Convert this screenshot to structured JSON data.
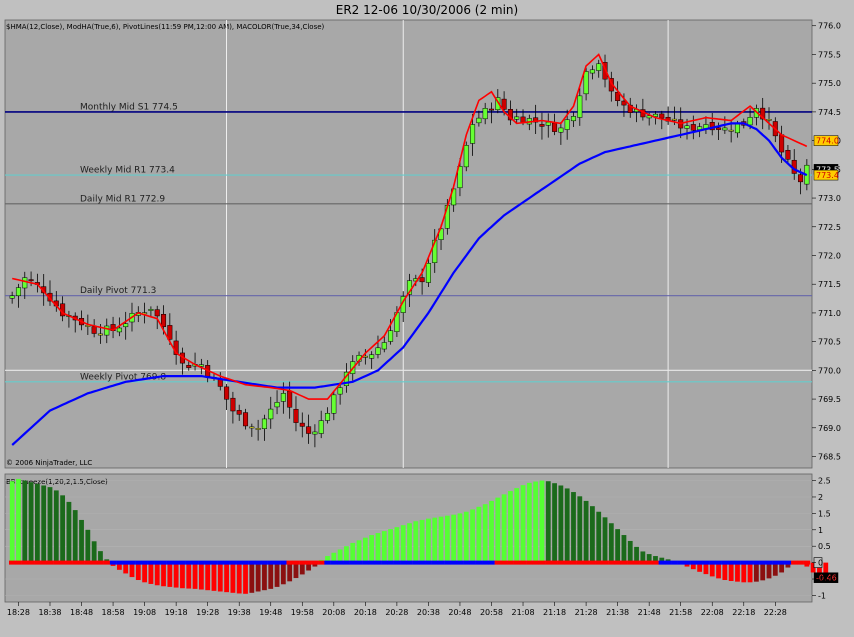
{
  "title": "ER2 12-06  10/30/2006  (2 min)",
  "price_indicator_label": "$HMA(12,Close), ModHA(True,6), PivotLines(11:59 PM,12:00 AM), MACOLOR(True,34,Close)",
  "copyright": "© 2006 NinjaTrader, LLC",
  "osc_indicator_label": "BBSqueeze(1,20,2,1.5,Close)",
  "colors": {
    "background": "#c0c0c0",
    "bull_candle": "#66ff33",
    "bear_candle": "#cc0000",
    "doji_candle": "#ffff33",
    "hma": "#ff0000",
    "ma": "#0000ff",
    "hist_pos_up": "#55ff33",
    "hist_pos_down": "#1b6a1b",
    "hist_neg_down": "#ff0000",
    "hist_neg_up": "#8b1010",
    "squeeze_on": "#ff0000",
    "squeeze_off": "#0000ff"
  },
  "chart_data": [
    {
      "type": "candlestick",
      "panel": "price",
      "ylim": [
        768.3,
        776.1
      ],
      "ticks": [
        776.0,
        775.5,
        775.0,
        774.5,
        774.0,
        773.5,
        773.0,
        772.5,
        772.0,
        771.5,
        771.0,
        770.5,
        770.0,
        769.5,
        769.0,
        768.5
      ],
      "tick_labels": [
        "776.0",
        "775.5",
        "775.0",
        "774.5",
        "774.0",
        "773.5",
        "773.0",
        "772.5",
        "772.0",
        "771.5",
        "771.0",
        "770.5",
        "770.0",
        "769.5",
        "769.0",
        "768.5"
      ],
      "time_labels": [
        "18:28",
        "18:38",
        "18:48",
        "18:58",
        "19:08",
        "19:18",
        "19:28",
        "19:38",
        "19:48",
        "19:58",
        "20:08",
        "20:18",
        "20:28",
        "20:38",
        "20:48",
        "20:58",
        "21:08",
        "21:18",
        "21:28",
        "21:38",
        "21:48",
        "21:58",
        "22:08",
        "22:18",
        "22:28"
      ],
      "close_path": [
        [
          0,
          771.3
        ],
        [
          2,
          771.6
        ],
        [
          5,
          771.4
        ],
        [
          8,
          771.0
        ],
        [
          10,
          770.9
        ],
        [
          13,
          770.7
        ],
        [
          16,
          770.7
        ],
        [
          20,
          771.0
        ],
        [
          22,
          771.1
        ],
        [
          25,
          770.6
        ],
        [
          27,
          770.1
        ],
        [
          30,
          770.1
        ],
        [
          33,
          769.7
        ],
        [
          35,
          769.3
        ],
        [
          37,
          769.1
        ],
        [
          39,
          769.0
        ],
        [
          41,
          769.3
        ],
        [
          43,
          769.6
        ],
        [
          45,
          769.1
        ],
        [
          47,
          768.9
        ],
        [
          49,
          769.1
        ],
        [
          51,
          769.5
        ],
        [
          53,
          770.0
        ],
        [
          55,
          770.2
        ],
        [
          57,
          770.3
        ],
        [
          59,
          770.5
        ],
        [
          61,
          771.0
        ],
        [
          63,
          771.5
        ],
        [
          65,
          771.6
        ],
        [
          67,
          772.2
        ],
        [
          69,
          772.8
        ],
        [
          71,
          773.5
        ],
        [
          73,
          774.3
        ],
        [
          75,
          774.5
        ],
        [
          77,
          774.7
        ],
        [
          79,
          774.4
        ],
        [
          81,
          774.4
        ],
        [
          84,
          774.3
        ],
        [
          87,
          774.2
        ],
        [
          89,
          774.5
        ],
        [
          91,
          775.2
        ],
        [
          93,
          775.4
        ],
        [
          95,
          774.8
        ],
        [
          97,
          774.6
        ],
        [
          99,
          774.5
        ],
        [
          103,
          774.4
        ],
        [
          107,
          774.2
        ],
        [
          110,
          774.3
        ],
        [
          113,
          774.2
        ],
        [
          116,
          774.3
        ],
        [
          118,
          774.6
        ],
        [
          120,
          774.3
        ],
        [
          122,
          773.8
        ],
        [
          124,
          773.4
        ],
        [
          125,
          773.3
        ],
        [
          126,
          773.5
        ]
      ],
      "hma_path": [
        [
          0,
          771.6
        ],
        [
          4,
          771.5
        ],
        [
          8,
          771.0
        ],
        [
          12,
          770.8
        ],
        [
          16,
          770.7
        ],
        [
          20,
          771.0
        ],
        [
          23,
          770.9
        ],
        [
          26,
          770.3
        ],
        [
          29,
          770.1
        ],
        [
          33,
          769.9
        ],
        [
          37,
          769.75
        ],
        [
          41,
          769.7
        ],
        [
          44,
          769.65
        ],
        [
          47,
          769.5
        ],
        [
          50,
          769.5
        ],
        [
          53,
          769.9
        ],
        [
          56,
          770.3
        ],
        [
          59,
          770.6
        ],
        [
          62,
          771.2
        ],
        [
          65,
          771.7
        ],
        [
          68,
          772.5
        ],
        [
          70,
          773.2
        ],
        [
          72,
          774.1
        ],
        [
          74,
          774.7
        ],
        [
          76,
          774.85
        ],
        [
          78,
          774.5
        ],
        [
          80,
          774.3
        ],
        [
          84,
          774.35
        ],
        [
          87,
          774.3
        ],
        [
          89,
          774.6
        ],
        [
          91,
          775.3
        ],
        [
          93,
          775.5
        ],
        [
          95,
          775.0
        ],
        [
          98,
          774.6
        ],
        [
          102,
          774.4
        ],
        [
          106,
          774.3
        ],
        [
          110,
          774.4
        ],
        [
          114,
          774.35
        ],
        [
          117,
          774.6
        ],
        [
          120,
          774.3
        ],
        [
          122,
          774.1
        ],
        [
          124,
          774.0
        ],
        [
          126,
          773.9
        ]
      ],
      "ma_path": [
        [
          0,
          768.7
        ],
        [
          6,
          769.3
        ],
        [
          12,
          769.6
        ],
        [
          18,
          769.8
        ],
        [
          24,
          769.9
        ],
        [
          30,
          769.9
        ],
        [
          36,
          769.8
        ],
        [
          42,
          769.7
        ],
        [
          48,
          769.7
        ],
        [
          54,
          769.8
        ],
        [
          58,
          770.0
        ],
        [
          62,
          770.4
        ],
        [
          66,
          771.0
        ],
        [
          70,
          771.7
        ],
        [
          74,
          772.3
        ],
        [
          78,
          772.7
        ],
        [
          82,
          773.0
        ],
        [
          86,
          773.3
        ],
        [
          90,
          773.6
        ],
        [
          94,
          773.8
        ],
        [
          98,
          773.9
        ],
        [
          102,
          774.0
        ],
        [
          106,
          774.1
        ],
        [
          110,
          774.2
        ],
        [
          114,
          774.3
        ],
        [
          116,
          774.3
        ],
        [
          118,
          774.2
        ],
        [
          120,
          774.0
        ],
        [
          122,
          773.7
        ],
        [
          124,
          773.5
        ],
        [
          126,
          773.4
        ]
      ],
      "levels": [
        {
          "name": "Weekly R1 / Monthly Mid",
          "value": 774.5,
          "color": "#000080",
          "label": "Monthly Mid S1 774.5"
        },
        {
          "name": "Weekly Mid R1",
          "value": 773.4,
          "color": "#66cccc",
          "label": "Weekly Mid R1 773.4"
        },
        {
          "name": "Daily Mid R1",
          "value": 772.9,
          "color": "#666666",
          "label": "Daily Mid R1 772.9"
        },
        {
          "name": "Daily Pivot",
          "value": 771.3,
          "color": "#6666aa",
          "label": "Daily Pivot 771.3"
        },
        {
          "name": "Weekly Pivot",
          "value": 769.8,
          "color": "#66cccc",
          "label": "Weekly Pivot 769.8"
        },
        {
          "name": "Level 770.0",
          "value": 770.0,
          "color": "#e8e8e8",
          "label": ""
        }
      ],
      "badges": [
        {
          "value": 774.0,
          "label": "774.0",
          "bg": "#ffcc00",
          "fg": "#cc0000"
        },
        {
          "value": 773.5,
          "label": "773.5",
          "bg": "#000000",
          "fg": "#ffffff"
        },
        {
          "value": 773.4,
          "label": "773.4",
          "bg": "#ffcc00",
          "fg": "#cc0000"
        }
      ]
    },
    {
      "type": "bar",
      "panel": "oscillator",
      "ylim": [
        -1.2,
        2.7
      ],
      "ticks": [
        2.5,
        2.0,
        1.5,
        1.0,
        0.5,
        0.0,
        -0.5,
        -1.0
      ],
      "tick_labels": [
        "2.5",
        "2",
        "1.5",
        "1",
        "0.5",
        "0",
        "-0.5",
        "-1"
      ],
      "current_value_label": "-0.46",
      "values": [
        2.48,
        2.55,
        2.5,
        2.45,
        2.4,
        2.35,
        2.3,
        2.2,
        2.05,
        1.85,
        1.6,
        1.3,
        1.0,
        0.65,
        0.35,
        0.1,
        -0.1,
        -0.22,
        -0.33,
        -0.44,
        -0.53,
        -0.6,
        -0.65,
        -0.69,
        -0.72,
        -0.74,
        -0.76,
        -0.78,
        -0.79,
        -0.8,
        -0.82,
        -0.84,
        -0.86,
        -0.88,
        -0.9,
        -0.92,
        -0.94,
        -0.95,
        -0.92,
        -0.88,
        -0.84,
        -0.8,
        -0.74,
        -0.66,
        -0.57,
        -0.47,
        -0.36,
        -0.24,
        -0.12,
        0.08,
        0.2,
        0.3,
        0.4,
        0.5,
        0.6,
        0.68,
        0.76,
        0.84,
        0.9,
        0.96,
        1.02,
        1.08,
        1.14,
        1.2,
        1.26,
        1.3,
        1.34,
        1.37,
        1.4,
        1.43,
        1.46,
        1.5,
        1.55,
        1.62,
        1.7,
        1.78,
        1.88,
        1.98,
        2.08,
        2.18,
        2.27,
        2.36,
        2.43,
        2.47,
        2.5,
        2.48,
        2.42,
        2.35,
        2.26,
        2.15,
        2.02,
        1.88,
        1.72,
        1.55,
        1.38,
        1.2,
        1.02,
        0.84,
        0.66,
        0.48,
        0.34,
        0.26,
        0.2,
        0.15,
        0.1,
        0.04,
        -0.05,
        -0.12,
        -0.2,
        -0.28,
        -0.35,
        -0.42,
        -0.48,
        -0.53,
        -0.56,
        -0.58,
        -0.6,
        -0.6,
        -0.58,
        -0.54,
        -0.48,
        -0.4,
        -0.3,
        -0.15,
        0.0,
        0.05,
        -0.12,
        -0.3,
        -0.38,
        -0.46
      ],
      "squeeze_on": [
        [
          0,
          15
        ],
        [
          44,
          49
        ],
        [
          77,
          102
        ],
        [
          124,
          126
        ]
      ]
    }
  ]
}
